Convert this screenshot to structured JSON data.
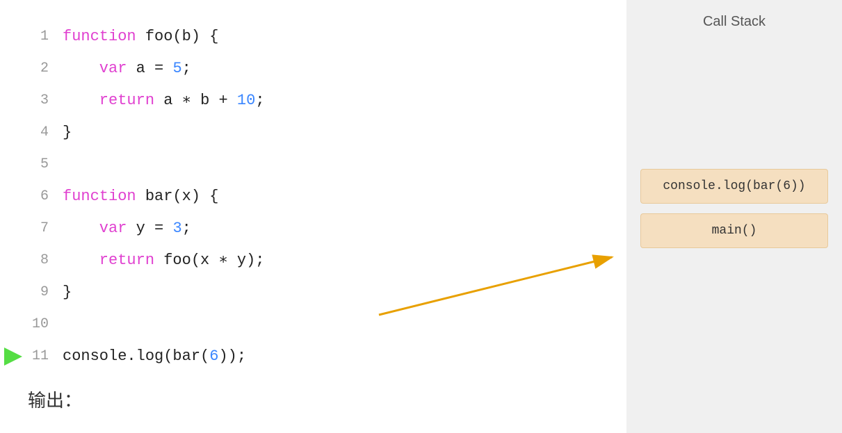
{
  "callStack": {
    "title": "Call Stack",
    "items": [
      {
        "label": "console.log(bar(6))"
      },
      {
        "label": "main()"
      }
    ]
  },
  "code": {
    "lines": [
      {
        "num": "1",
        "content": "function foo(b) {"
      },
      {
        "num": "2",
        "content": "    var a = 5;"
      },
      {
        "num": "3",
        "content": "    return a * b + 10;"
      },
      {
        "num": "4",
        "content": "}"
      },
      {
        "num": "5",
        "content": ""
      },
      {
        "num": "6",
        "content": "function bar(x) {"
      },
      {
        "num": "7",
        "content": "    var y = 3;"
      },
      {
        "num": "8",
        "content": "    return foo(x * y);"
      },
      {
        "num": "9",
        "content": "}"
      },
      {
        "num": "10",
        "content": ""
      },
      {
        "num": "11",
        "content": "console.log(bar(6));"
      }
    ],
    "currentLine": "11"
  },
  "output": {
    "label": "输出："
  }
}
